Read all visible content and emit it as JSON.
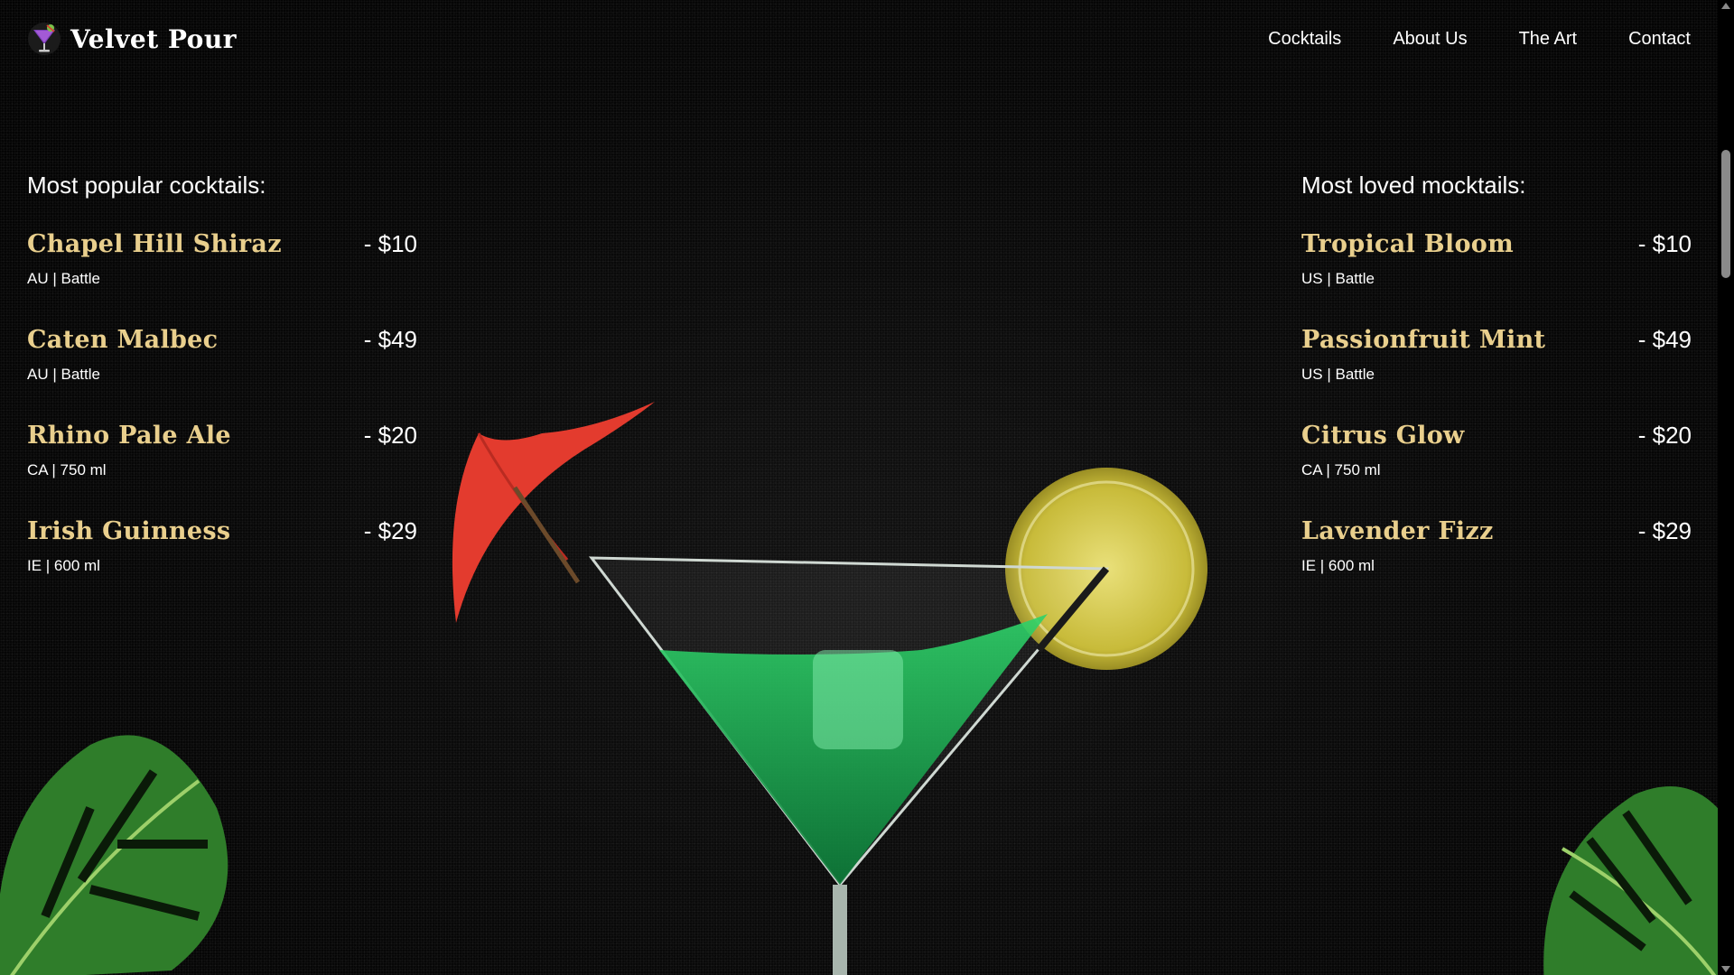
{
  "brand": {
    "name": "Velvet Pour",
    "logo_icon": "cocktail-glass-icon"
  },
  "nav": {
    "items": [
      "Cocktails",
      "About Us",
      "The Art",
      "Contact"
    ]
  },
  "cocktails": {
    "heading": "Most popular cocktails:",
    "items": [
      {
        "name": "Chapel Hill Shiraz",
        "price": "- $10",
        "meta": "AU | Battle"
      },
      {
        "name": "Caten Malbec",
        "price": "- $49",
        "meta": "AU | Battle"
      },
      {
        "name": "Rhino Pale Ale",
        "price": "- $20",
        "meta": "CA | 750 ml"
      },
      {
        "name": "Irish Guinness",
        "price": "- $29",
        "meta": "IE | 600 ml"
      }
    ]
  },
  "mocktails": {
    "heading": "Most loved mocktails:",
    "items": [
      {
        "name": "Tropical Bloom",
        "price": "- $10",
        "meta": "US | Battle"
      },
      {
        "name": "Passionfruit Mint",
        "price": "- $49",
        "meta": "US | Battle"
      },
      {
        "name": "Citrus Glow",
        "price": "- $20",
        "meta": "CA | 750 ml"
      },
      {
        "name": "Lavender Fizz",
        "price": "- $29",
        "meta": "IE | 600 ml"
      }
    ]
  },
  "colors": {
    "accent_gold": "#e9cf8d",
    "background": "#050505"
  }
}
